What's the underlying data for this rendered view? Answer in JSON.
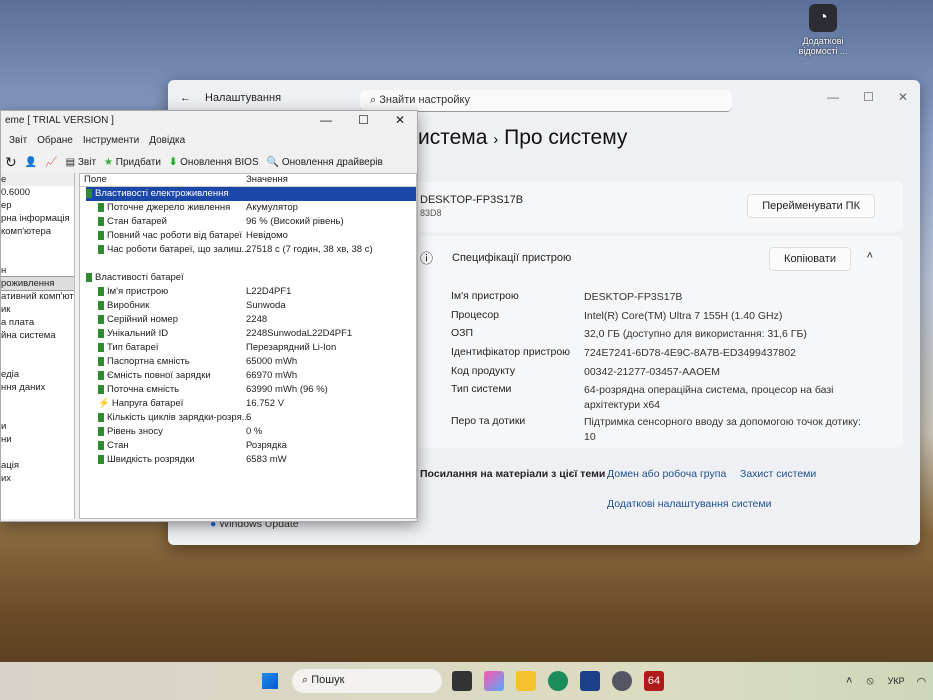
{
  "desktop": {
    "icon_label": "Додаткові відомості ..."
  },
  "settings": {
    "app_title": "Налаштування",
    "search_placeholder": "Знайти настройку",
    "breadcrumb_parent": "истема",
    "breadcrumb_sep": "›",
    "page_title": "Про систему",
    "device_name": "DESKTOP-FP3S17B",
    "device_model": "83D8",
    "rename_btn": "Перейменувати ПК",
    "specs_title": "Специфікації пристрою",
    "copy_btn": "Копіювати",
    "specs": [
      {
        "k": "Ім'я пристрою",
        "v": "DESKTOP-FP3S17B"
      },
      {
        "k": "Процесор",
        "v": "Intel(R) Core(TM) Ultra 7 155H (1.40 GHz)"
      },
      {
        "k": "ОЗП",
        "v": "32,0 ГБ (доступно для використання: 31,6 ГБ)"
      },
      {
        "k": "Ідентифікатор пристрою",
        "v": "724E7241-6D78-4E9C-8A7B-ED3499437802"
      },
      {
        "k": "Код продукту",
        "v": "00342-21277-03457-AAOEM"
      },
      {
        "k": "Тип системи",
        "v": "64-розрядна операційна система, процесор на базі архітектури x64"
      },
      {
        "k": "Перо та дотики",
        "v": "Підтримка сенсорного вводу за допомогою точок дотику: 10"
      }
    ],
    "related_label": "Посилання на матеріали з цієї теми",
    "links": [
      "Домен або робоча група",
      "Захист системи",
      "Додаткові налаштування системи"
    ],
    "windows_update": "Windows Update"
  },
  "aida": {
    "title": "eme  [ TRIAL VERSION ]",
    "menu": [
      "Звіт",
      "Обране",
      "Інструменти",
      "Довідка"
    ],
    "toolbar": [
      "Звіт",
      "Придбати",
      "Оновлення BIOS",
      "Оновлення драйверів"
    ],
    "sidebar_header": "е",
    "sidebar": [
      "0.6000",
      "ер",
      "рна інформація",
      "комп'ютера",
      "",
      "",
      "н",
      "роживлення",
      "ативний комп'юте",
      "ик",
      "а плата",
      "йна система",
      "",
      "",
      "едіа",
      "ння даних",
      "",
      "",
      "и",
      "ни",
      "",
      "ація",
      "их"
    ],
    "col_field": "Поле",
    "col_value": "Значення",
    "group1": "Властивості електроживлення",
    "rows1": [
      {
        "f": "Поточне джерело живлення",
        "v": "Акумулятор"
      },
      {
        "f": "Стан батарей",
        "v": "96 % (Високий рівень)"
      },
      {
        "f": "Повний час роботи від батареї",
        "v": "Невідомо"
      },
      {
        "f": "Час роботи батареї, що залиш...",
        "v": "27518 с (7 годин, 38 хв, 38 с)"
      }
    ],
    "group2": "Властивості батареї",
    "rows2": [
      {
        "f": "Ім'я пристрою",
        "v": "L22D4PF1"
      },
      {
        "f": "Виробник",
        "v": "Sunwoda"
      },
      {
        "f": "Серійний номер",
        "v": "2248"
      },
      {
        "f": "Унікальний ID",
        "v": "2248SunwodaL22D4PF1"
      },
      {
        "f": "Тип батареї",
        "v": "Перезарядний Li-Ion"
      },
      {
        "f": "Паспортна ємність",
        "v": "65000 mWh"
      },
      {
        "f": "Ємність повної зарядки",
        "v": "66970 mWh"
      },
      {
        "f": "Поточна ємність",
        "v": "63990 mWh  (96 %)"
      },
      {
        "f": "Напруга батареї",
        "v": "16.752 V"
      },
      {
        "f": "Кількість циклів зарядки-розря...",
        "v": "6"
      },
      {
        "f": "Рівень зносу",
        "v": "0 %"
      },
      {
        "f": "Стан",
        "v": "Розрядка"
      },
      {
        "f": "Швидкість розрядки",
        "v": "6583 mW"
      }
    ]
  },
  "taskbar": {
    "search": "Пошук",
    "aida_icon": "64",
    "lang": "УКР"
  }
}
